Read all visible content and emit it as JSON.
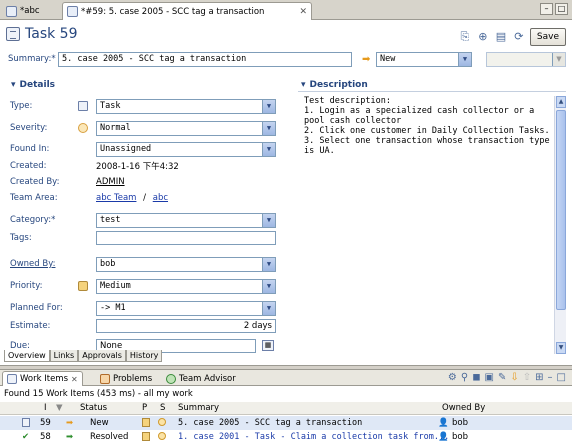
{
  "editor_tabs": [
    {
      "label": "*abc"
    },
    {
      "label": "*#59: 5. case 2005 - SCC tag a transaction"
    }
  ],
  "header": {
    "title": "Task 59",
    "save_label": "Save"
  },
  "summary": {
    "label": "Summary:*",
    "value": "5. case 2005 - SCC tag a transaction",
    "state": "New",
    "resolution": ""
  },
  "details": {
    "heading": "Details",
    "fields": {
      "type": {
        "label": "Type:",
        "value": "Task"
      },
      "severity": {
        "label": "Severity:",
        "value": "Normal"
      },
      "found_in": {
        "label": "Found In:",
        "value": "Unassigned"
      },
      "created": {
        "label": "Created:",
        "value": "2008-1-16 下午4:32"
      },
      "created_by": {
        "label": "Created By:",
        "value": "ADMIN"
      },
      "team_area": {
        "label": "Team Area:",
        "value": "abc Team",
        "sep": "/",
        "value2": "abc"
      },
      "category": {
        "label": "Category:*",
        "value": "test"
      },
      "tags": {
        "label": "Tags:",
        "value": ""
      },
      "owned_by": {
        "label": "Owned By:",
        "value": "bob"
      },
      "priority": {
        "label": "Priority:",
        "value": "Medium"
      },
      "planned_for": {
        "label": "Planned For:",
        "value": "-> M1"
      },
      "estimate": {
        "label": "Estimate:",
        "value": "2 days"
      },
      "due": {
        "label": "Due:",
        "value": "None"
      }
    }
  },
  "description": {
    "heading": "Description",
    "text": "Test description:\n1. Login as a specialized cash collector or a pool cash collector\n2. Click one customer in Daily Collection Tasks.\n3. Select one transaction whose transaction type is UA."
  },
  "editor_bottom_tabs": [
    "Overview",
    "Links",
    "Approvals",
    "History"
  ],
  "view": {
    "tabs": [
      "Work Items",
      "Problems",
      "Team Advisor"
    ],
    "status": "Found 15 Work Items (453 ms) - all my work",
    "columns": [
      "I",
      "Status",
      "P",
      "S",
      "Summary",
      "Owned By"
    ],
    "rows": [
      {
        "id": "59",
        "status": "New",
        "summary": "5. case 2005 - SCC tag a transaction",
        "owner": "bob"
      },
      {
        "id": "58",
        "status": "Resolved",
        "summary": "1. case 2001 - Task - Claim a collection task from...",
        "owner": "bob"
      }
    ]
  }
}
